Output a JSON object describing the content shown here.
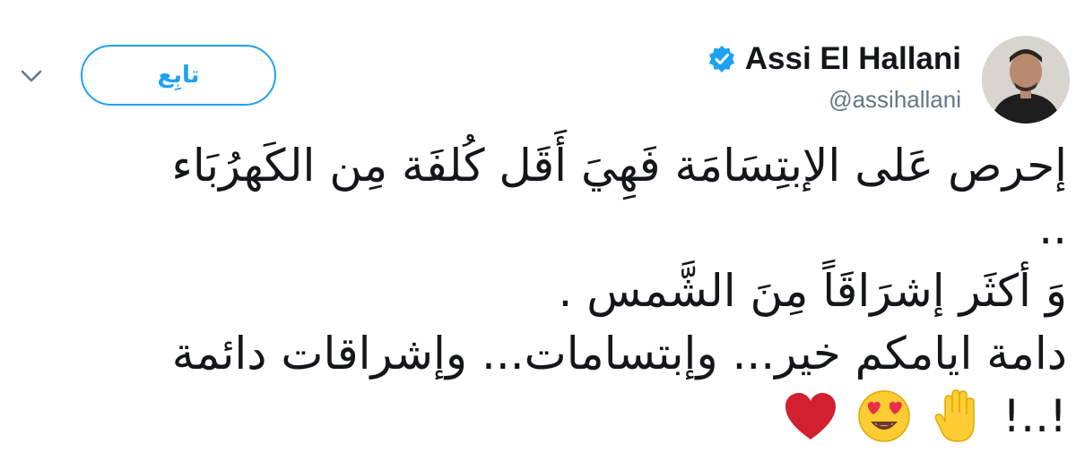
{
  "user": {
    "display_name": "Assi El Hallani",
    "handle": "@assihallani",
    "verified": true
  },
  "actions": {
    "follow_label": "تابِع",
    "menu_icon": "chevron-down-icon"
  },
  "tweet": {
    "lines": [
      "إحرص عَلى الإبتِسَامَة فَهِيَ أَقَل كُلفَة مِن الكَهرُبَاء",
      "..",
      "وَ أكثَر إشرَاقَاً مِنَ الشَّمس .",
      "دامة ايامكم  خير... وإبتسامات... وإشراقات دائمة",
      "!..!"
    ],
    "emojis": [
      "raised-hand-icon",
      "heart-eyes-icon",
      "red-heart-icon"
    ]
  },
  "colors": {
    "accent": "#1da1f2",
    "text": "#14171a",
    "secondary": "#657786"
  }
}
